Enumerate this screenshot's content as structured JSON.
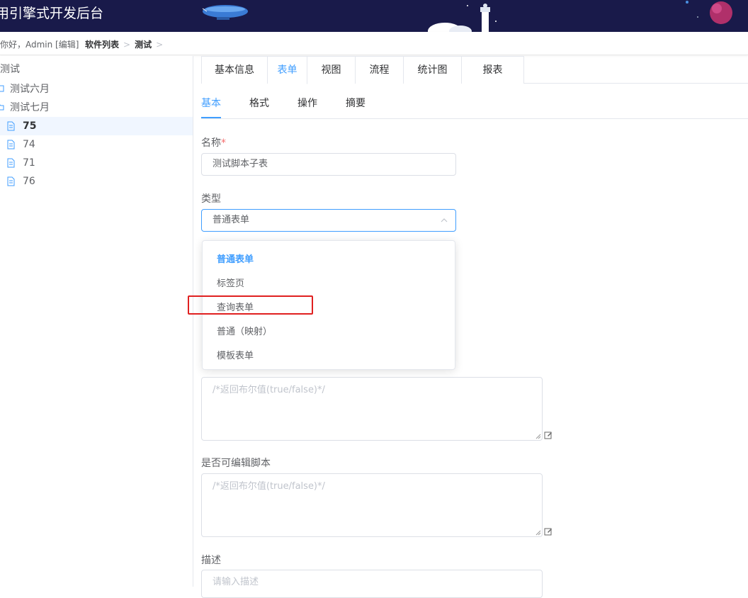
{
  "header": {
    "app_title": "用引擎式开发后台",
    "colors": {
      "background": "#191a4a",
      "accent": "#409eff"
    }
  },
  "breadcrumb": {
    "greeting": "你好，Admin [编辑]",
    "items": [
      "软件列表",
      "测试"
    ]
  },
  "sidebar": {
    "root": "测试",
    "items": [
      {
        "label": "测试六月",
        "icon": "folder-icon"
      },
      {
        "label": "测试七月",
        "icon": "folder-open-icon"
      },
      {
        "label": "75",
        "icon": "document-icon",
        "active": true
      },
      {
        "label": "74",
        "icon": "document-icon"
      },
      {
        "label": "71",
        "icon": "document-icon"
      },
      {
        "label": "76",
        "icon": "document-icon"
      }
    ]
  },
  "main_tabs": [
    "基本信息",
    "表单",
    "视图",
    "流程",
    "统计图",
    "报表"
  ],
  "main_tab_active": "表单",
  "sub_tabs": [
    "基本",
    "格式",
    "操作",
    "摘要"
  ],
  "sub_tab_active": "基本",
  "form": {
    "name_label": "名称",
    "name_required_mark": "*",
    "name_value": "测试脚本子表",
    "type_label": "类型",
    "type_value": "普通表单",
    "type_options": [
      "普通表单",
      "标签页",
      "查询表单",
      "普通（映射）",
      "模板表单"
    ],
    "type_selected": "普通表单",
    "script1_placeholder": "/*返回布尔值(true/false)*/",
    "editable_script_label": "是否可编辑脚本",
    "script2_placeholder": "/*返回布尔值(true/false)*/",
    "description_label": "描述",
    "description_placeholder": "请输入描述"
  }
}
